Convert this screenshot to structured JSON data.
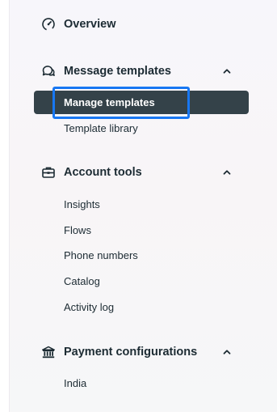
{
  "sidebar": {
    "overview": {
      "label": "Overview",
      "icon": "speedometer-icon"
    },
    "message_templates": {
      "label": "Message templates",
      "icon": "chat-bubbles-icon",
      "items": [
        {
          "label": "Manage templates",
          "active": true
        },
        {
          "label": "Template library"
        }
      ]
    },
    "account_tools": {
      "label": "Account tools",
      "icon": "toolbox-icon",
      "items": [
        {
          "label": "Insights"
        },
        {
          "label": "Flows"
        },
        {
          "label": "Phone numbers"
        },
        {
          "label": "Catalog"
        },
        {
          "label": "Activity log"
        }
      ]
    },
    "payment_configurations": {
      "label": "Payment configurations",
      "icon": "bank-icon",
      "items": [
        {
          "label": "India"
        }
      ]
    }
  },
  "colors": {
    "active_bg": "#344249",
    "focus_ring": "#1877f2",
    "text": "#1c2b33"
  }
}
